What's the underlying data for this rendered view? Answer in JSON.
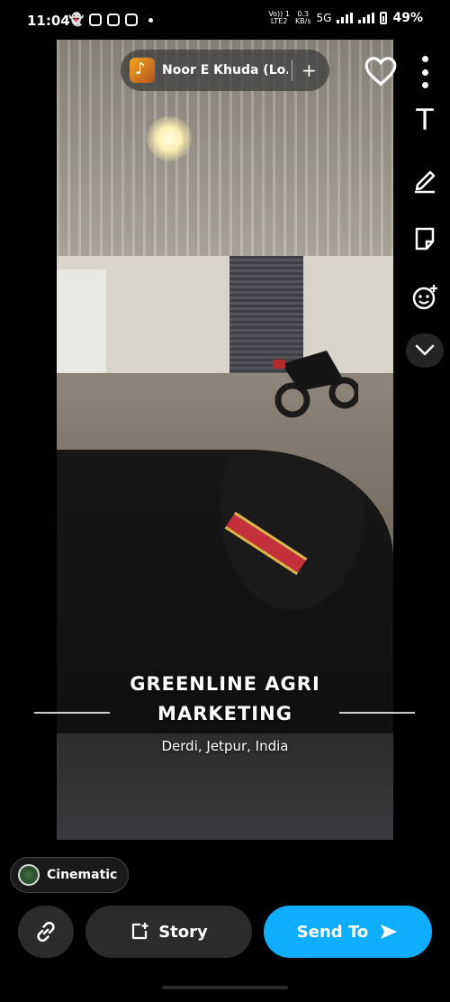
{
  "status_bar": {
    "time": "11:04",
    "network_label_top": "Vo)) 1",
    "network_label_bottom": "LTE2",
    "speed_top": "0.3",
    "speed_bottom": "KB/s",
    "network_type": "5G",
    "battery": "49%"
  },
  "music": {
    "title": "Noor E Khuda (Lo...",
    "add_label": "+"
  },
  "toolbar": {
    "text_tool_label": "T",
    "tools": [
      "text-icon",
      "pencil-icon",
      "sticker-icon",
      "lens-icon",
      "chevron-down-icon"
    ]
  },
  "caption": {
    "title_line1": "GREENLINE AGRI",
    "title_line2": "MARKETING",
    "location": "Derdi, Jetpur, India"
  },
  "lens": {
    "label": "Cinematic"
  },
  "actions": {
    "story_label": "Story",
    "send_label": "Send To"
  },
  "colors": {
    "accent": "#0fadff",
    "button_bg": "#2b2b2b",
    "background": "#000000"
  }
}
